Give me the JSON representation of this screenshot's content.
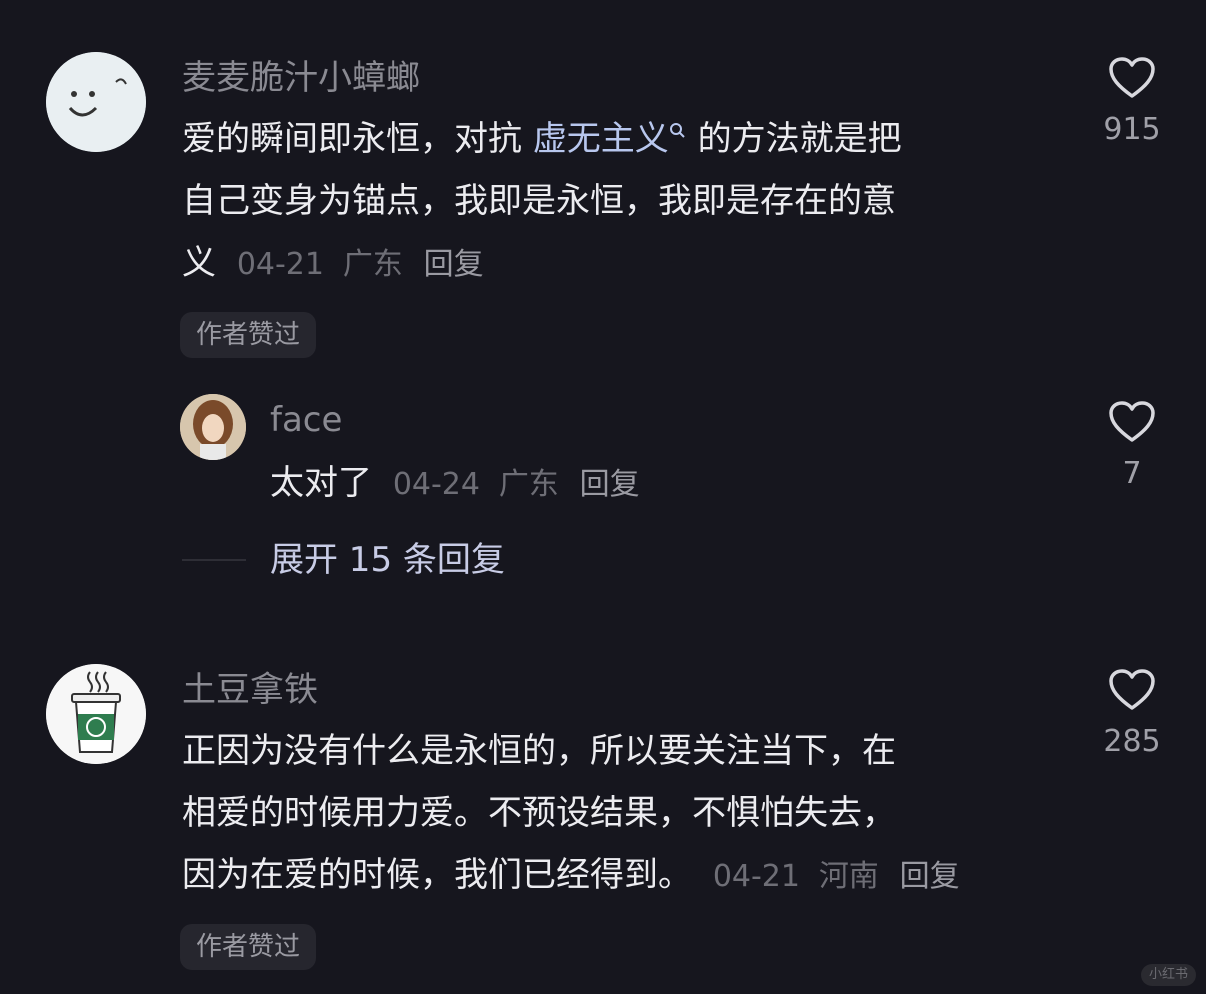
{
  "comments": [
    {
      "username": "麦麦脆汁小蟑螂",
      "text_lines": [
        "爱的瞬间即永恒，对抗 ",
        "自己变身为锚点，我即是永恒，我即是存在的意",
        "义"
      ],
      "link_text": "虚无主义",
      "after_link": " 的方法就是把",
      "date": "04-21",
      "location": "广东",
      "reply_label": "回复",
      "badge": "作者赞过",
      "likes": "915"
    },
    {
      "username": "土豆拿铁",
      "text_lines": [
        "正因为没有什么是永恒的，所以要关注当下，在",
        "相爱的时候用力爱。不预设结果，不惧怕失去，",
        "因为在爱的时候，我们已经得到。"
      ],
      "date": "04-21",
      "location": "河南",
      "reply_label": "回复",
      "badge": "作者赞过",
      "likes": "285"
    }
  ],
  "reply": {
    "username": "face",
    "text": "太对了",
    "date": "04-24",
    "location": "广东",
    "reply_label": "回复",
    "likes": "7"
  },
  "expand_label": "展开 15 条回复",
  "watermark": "小红书",
  "colors": {
    "background": "#16161e",
    "link": "#b8c7ee",
    "badge_bg": "#26262e"
  },
  "icons": [
    "heart-outline-icon",
    "search-icon"
  ]
}
